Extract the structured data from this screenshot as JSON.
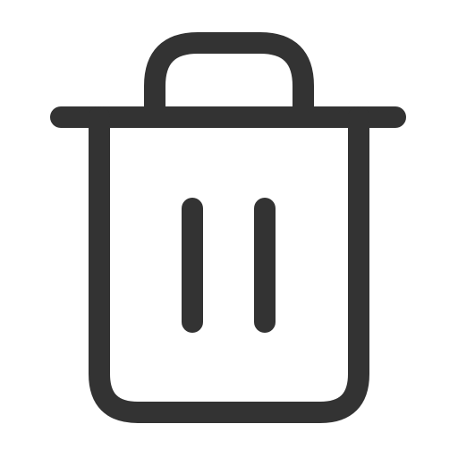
{
  "icon": {
    "name": "trash-icon",
    "color": "#333333",
    "background": "#ffffff"
  }
}
